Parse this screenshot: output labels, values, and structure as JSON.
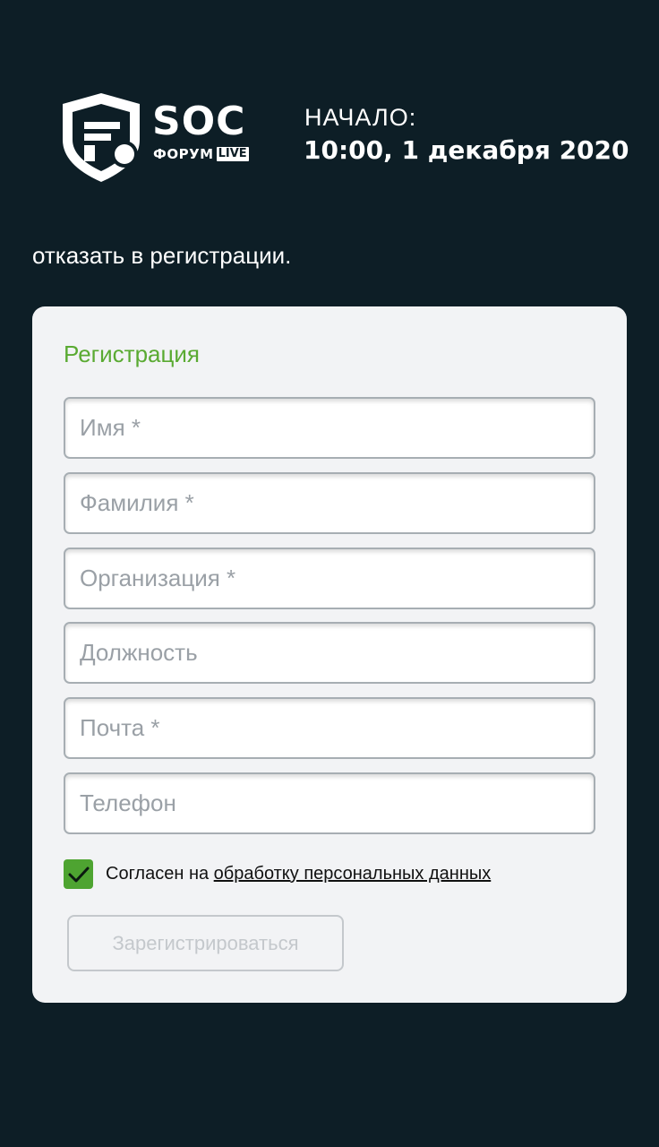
{
  "header": {
    "logo": {
      "name": "SOC",
      "subtitle": "ФОРУМ",
      "badge": "LIVE"
    },
    "start_label": "НАЧАЛО:",
    "start_date": "10:00, 1 декабря 2020"
  },
  "intro_text": "отказать в регистрации.",
  "form": {
    "title": "Регистрация",
    "fields": [
      {
        "placeholder": "Имя *",
        "value": ""
      },
      {
        "placeholder": "Фамилия *",
        "value": ""
      },
      {
        "placeholder": "Организация *",
        "value": ""
      },
      {
        "placeholder": "Должность",
        "value": ""
      },
      {
        "placeholder": "Почта *",
        "value": ""
      },
      {
        "placeholder": "Телефон",
        "value": ""
      }
    ],
    "consent": {
      "checked": true,
      "text": "Согласен на",
      "link_text": "обработку персональных данных"
    },
    "submit_label": "Зарегистрироваться"
  },
  "colors": {
    "background": "#0d1e26",
    "card": "#f2f3f5",
    "accent_green": "#5aaa32",
    "checkbox_green": "#4ea431",
    "disabled_button": "#c4c8cc"
  },
  "icons": {
    "logo": "soc-shield-logo-icon",
    "checkmark": "checkmark-icon"
  }
}
